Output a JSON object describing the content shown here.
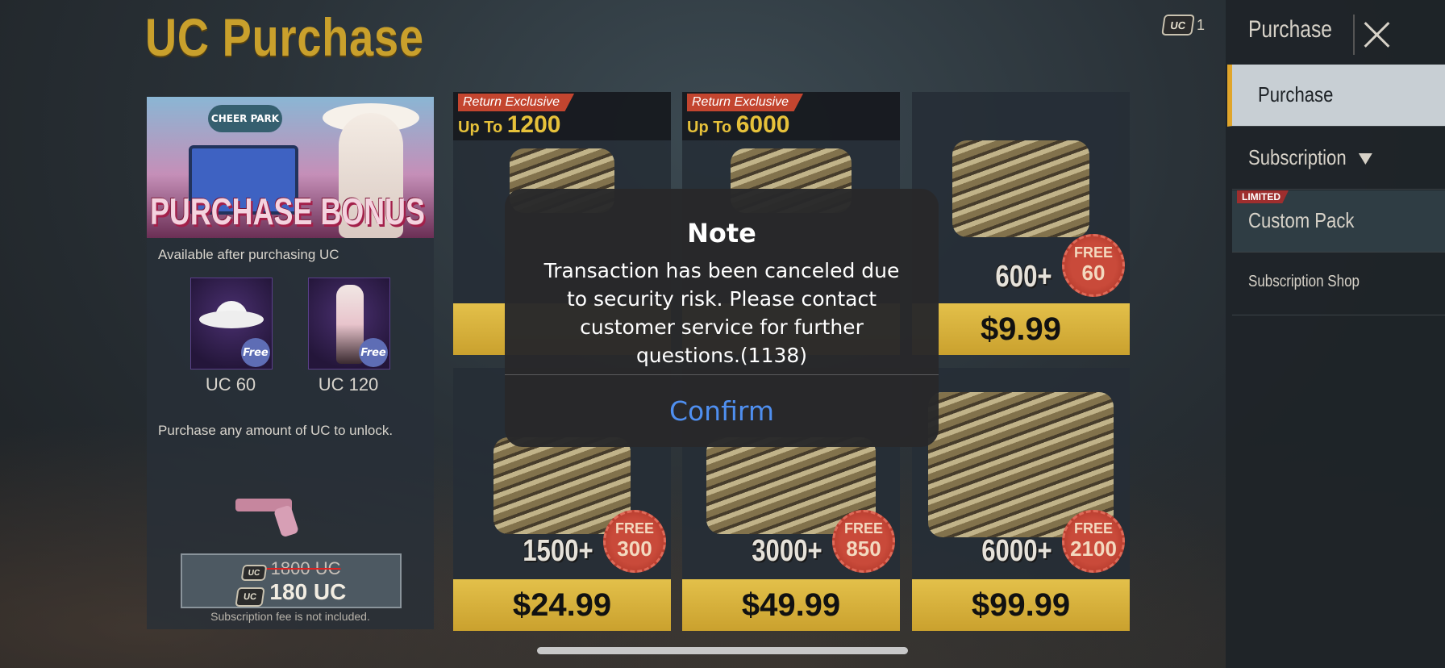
{
  "page": {
    "title": "UC Purchase",
    "uc_balance": "1"
  },
  "bonus": {
    "banner_text": "PURCHASE BONUS",
    "banner_sign": "CHEER PARK",
    "available_text": "Available after purchasing UC",
    "rewards": [
      {
        "label": "UC 60",
        "badge": "Free"
      },
      {
        "label": "UC 120",
        "badge": "Free"
      }
    ],
    "unlock_text": "Purchase any amount of UC to unlock.",
    "old_price": "1800 UC",
    "new_price": "180 UC",
    "fee_note": "Subscription fee is not included."
  },
  "products": [
    {
      "exclusive_tag": "Return Exclusive",
      "upto_prefix": "Up To",
      "upto_amount": "1200",
      "price": ""
    },
    {
      "exclusive_tag": "Return Exclusive",
      "upto_prefix": "Up To",
      "upto_amount": "6000",
      "price": ""
    },
    {
      "qty": "600+",
      "free_label": "FREE",
      "free_amount": "60",
      "price": "$9.99"
    },
    {
      "qty": "1500+",
      "free_label": "FREE",
      "free_amount": "300",
      "price": "$24.99"
    },
    {
      "qty": "3000+",
      "free_label": "FREE",
      "free_amount": "850",
      "price": "$49.99"
    },
    {
      "qty": "6000+",
      "free_label": "FREE",
      "free_amount": "2100",
      "price": "$99.99"
    }
  ],
  "sidebar": {
    "header": "Purchase",
    "items": [
      {
        "label": "Purchase",
        "active": true
      },
      {
        "label": "Subscription"
      },
      {
        "label": "Custom Pack",
        "tag": "LIMITED"
      },
      {
        "label": "Subscription Shop"
      }
    ]
  },
  "modal": {
    "title": "Note",
    "message": "Transaction has been canceled due to security risk. Please contact customer service for further questions.(1138)",
    "confirm_label": "Confirm"
  },
  "icons": {
    "uc": "uc-coin-icon",
    "close": "close-icon",
    "dropdown": "chevron-down-icon"
  },
  "colors": {
    "gold": "#c9a02c",
    "price_button": "#dbb63f",
    "confirm_blue": "#4f8ff0",
    "free_seal": "#c94a3a"
  }
}
